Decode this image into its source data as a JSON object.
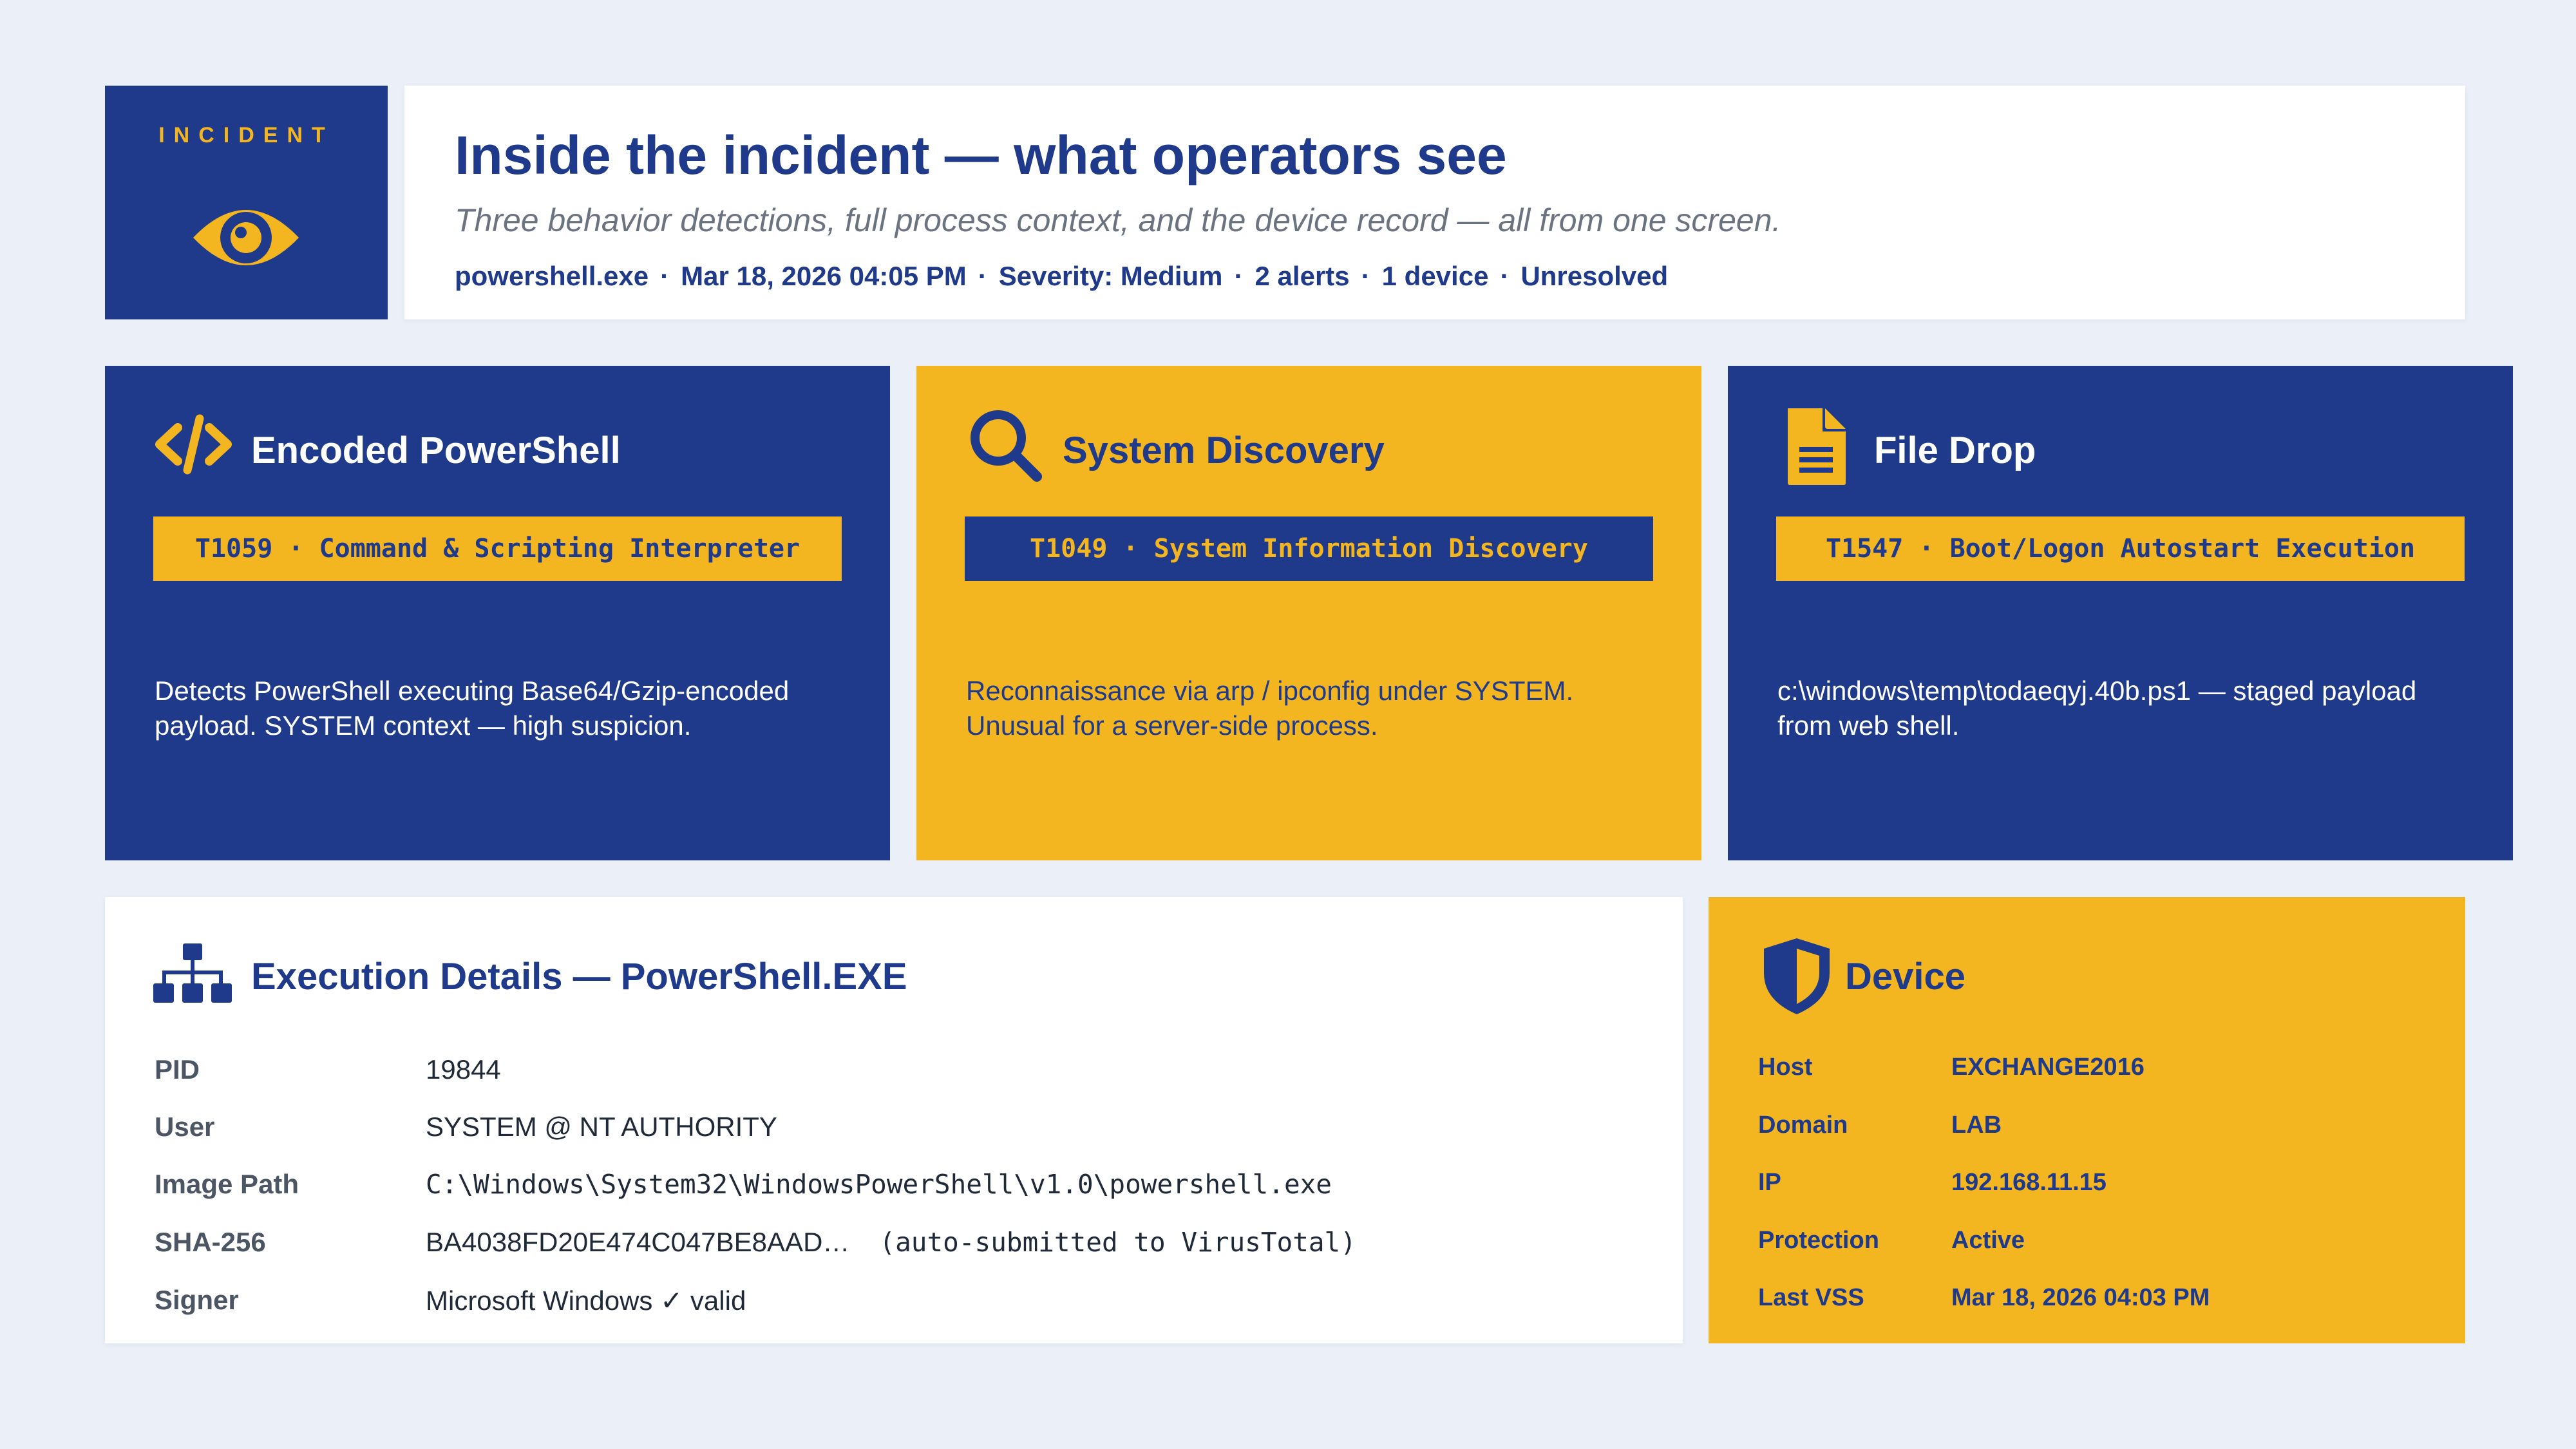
{
  "colors": {
    "navy": "#1f3a8a",
    "gold": "#f3b520",
    "background": "#ebeff7",
    "card": "#ffffff"
  },
  "badge": {
    "label": "INCIDENT",
    "icon": "eye-icon"
  },
  "header": {
    "title": "Inside the incident — what operators see",
    "subtitle": "Three behavior detections, full process context, and the device record — all from one screen.",
    "meta": {
      "process": "powershell.exe",
      "timestamp": "Mar 18, 2026 04:05 PM",
      "severity": "Severity: Medium",
      "alerts": "2 alerts",
      "devices": "1 device",
      "status": "Unresolved",
      "separator": "·"
    }
  },
  "alerts": [
    {
      "icon": "code-icon",
      "title": "Encoded PowerShell",
      "tag": "T1059 · Command & Scripting Interpreter",
      "description": "Detects PowerShell executing Base64/Gzip-encoded payload. SYSTEM context — high suspicion."
    },
    {
      "icon": "search-icon",
      "title": "System Discovery",
      "tag": "T1049 · System Information Discovery",
      "description": "Reconnaissance via arp / ipconfig under SYSTEM. Unusual for a server-side process."
    },
    {
      "icon": "document-icon",
      "title": "File Drop",
      "tag": "T1547 · Boot/Logon Autostart Execution",
      "description": "c:\\windows\\temp\\todaeqyj.40b.ps1 — staged payload from web shell."
    }
  ],
  "execution": {
    "icon": "process-tree-icon",
    "title": "Execution Details — PowerShell.EXE",
    "rows": [
      {
        "label": "PID",
        "value": "19844"
      },
      {
        "label": "User",
        "value": "SYSTEM @ NT AUTHORITY"
      },
      {
        "label": "Image Path",
        "value": "C:\\Windows\\System32\\WindowsPowerShell\\v1.0\\powershell.exe"
      },
      {
        "label": "SHA-256",
        "value": "BA4038FD20E474C047BE8AAD…",
        "note": "(auto-submitted to VirusTotal)"
      },
      {
        "label": "Signer",
        "value": "Microsoft Windows ✓ valid"
      }
    ]
  },
  "device": {
    "icon": "shield-icon",
    "title": "Device",
    "rows": [
      {
        "label": "Host",
        "value": "EXCHANGE2016"
      },
      {
        "label": "Domain",
        "value": "LAB"
      },
      {
        "label": "IP",
        "value": "192.168.11.15"
      },
      {
        "label": "Protection",
        "value": "Active"
      },
      {
        "label": "Last VSS",
        "value": "Mar 18, 2026 04:03 PM"
      }
    ]
  }
}
